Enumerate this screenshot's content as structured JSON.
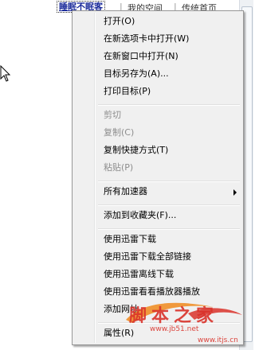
{
  "topbar": {
    "selected_link": "睡眠不眠客",
    "separator1": "|",
    "link2": "我的空间",
    "separator2": "|",
    "link3": "传统首页"
  },
  "menu": {
    "items": [
      {
        "label": "打开(O)",
        "disabled": false
      },
      {
        "label": "在新选项卡中打开(W)",
        "disabled": false
      },
      {
        "label": "在新窗口中打开(N)",
        "disabled": false
      },
      {
        "label": "目标另存为(A)...",
        "disabled": false
      },
      {
        "label": "打印目标(P)",
        "disabled": false
      },
      {
        "label": "剪切",
        "disabled": true
      },
      {
        "label": "复制(C)",
        "disabled": true
      },
      {
        "label": "复制快捷方式(T)",
        "disabled": false
      },
      {
        "label": "粘贴(P)",
        "disabled": true
      },
      {
        "label": "所有加速器",
        "disabled": false
      },
      {
        "label": "添加到收藏夹(F)...",
        "disabled": false
      },
      {
        "label": "使用迅雷下载",
        "disabled": false
      },
      {
        "label": "使用迅雷下载全部链接",
        "disabled": false
      },
      {
        "label": "使用迅雷离线下载",
        "disabled": false
      },
      {
        "label": "使用迅雷看看播放器播放",
        "disabled": false
      },
      {
        "label": "添加网址",
        "disabled": false
      },
      {
        "label": "属性(R)",
        "disabled": false
      }
    ]
  },
  "watermark": {
    "logo_text": "脚本之家",
    "url": "www.jb51.net",
    "url2": "www.itjs.cn"
  },
  "colors": {
    "menu_bg": "#f0f0f0",
    "menu_border": "#979797",
    "disabled_text": "#8d8d8d",
    "watermark_red": "#d9322a",
    "watermark_orange": "#f08a1c"
  }
}
